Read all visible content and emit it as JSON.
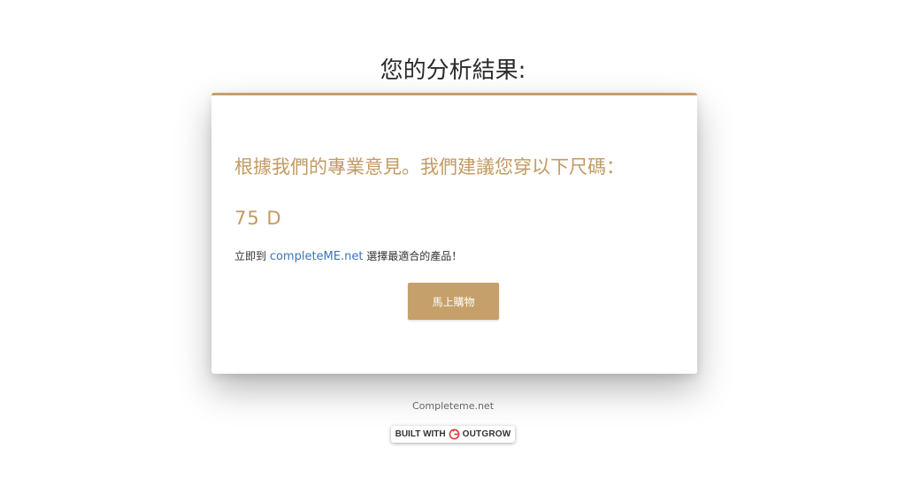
{
  "page": {
    "title": "您的分析結果:"
  },
  "result_card": {
    "heading": "根據我們的專業意見。我們建議您穿以下尺碼：",
    "size": "75 D",
    "cta_prefix": "立即到 ",
    "cta_link": "completeME.net",
    "cta_suffix": " 選擇最適合的產品！",
    "button_label": "馬上購物"
  },
  "footer": {
    "site_link": "Completeme.net",
    "badge_prefix": "BUILT WITH",
    "badge_brand": "OUTGROW"
  },
  "colors": {
    "accent": "#c6a06a",
    "accent_text": "#c29a63",
    "link": "#3a74b8",
    "badge_red": "#e0413d"
  },
  "icons": {
    "badge_logo": "outgrow-logo-icon"
  }
}
